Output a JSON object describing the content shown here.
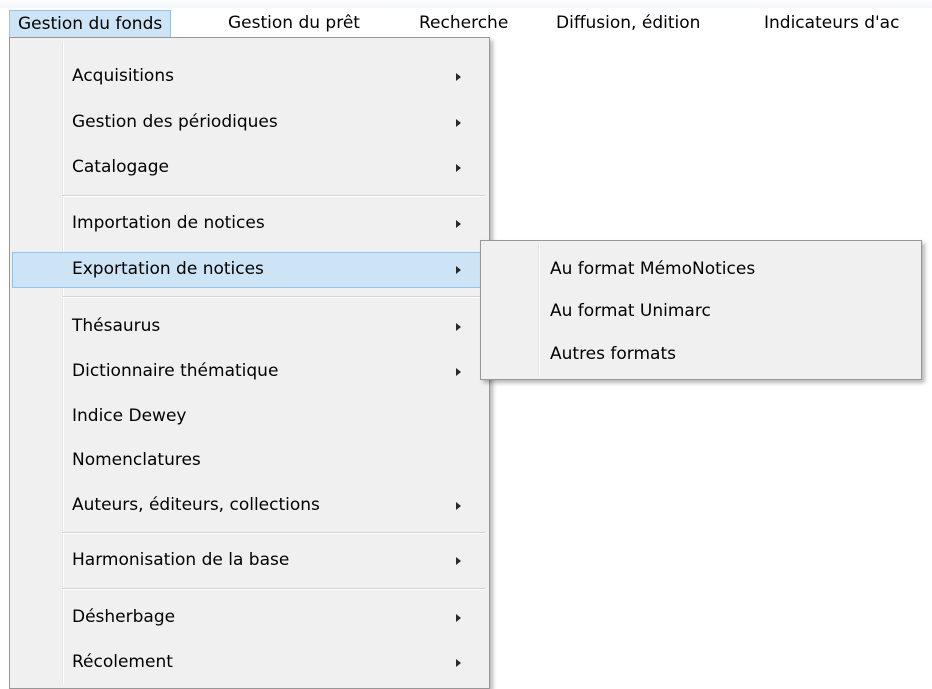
{
  "menubar": {
    "items": [
      {
        "label": "Gestion du fonds"
      },
      {
        "label": "Gestion du prêt"
      },
      {
        "label": "Recherche"
      },
      {
        "label": "Diffusion, édition"
      },
      {
        "label": "Indicateurs d'ac"
      }
    ]
  },
  "main_menu": {
    "items": [
      {
        "label": "Acquisitions",
        "submenu": true
      },
      {
        "label": "Gestion des périodiques",
        "submenu": true
      },
      {
        "label": "Catalogage",
        "submenu": true
      },
      {
        "label": "Importation de notices",
        "submenu": true
      },
      {
        "label": "Exportation de notices",
        "submenu": true,
        "highlighted": true
      },
      {
        "label": "Thésaurus",
        "submenu": true
      },
      {
        "label": "Dictionnaire thématique",
        "submenu": true
      },
      {
        "label": "Indice Dewey",
        "submenu": false
      },
      {
        "label": "Nomenclatures",
        "submenu": false
      },
      {
        "label": "Auteurs, éditeurs, collections",
        "submenu": true
      },
      {
        "label": "Harmonisation de la base",
        "submenu": true
      },
      {
        "label": "Désherbage",
        "submenu": true
      },
      {
        "label": "Récolement",
        "submenu": true
      }
    ]
  },
  "export_submenu": {
    "items": [
      {
        "label": "Au format MémoNotices"
      },
      {
        "label": "Au format Unimarc"
      },
      {
        "label": "Autres formats"
      }
    ]
  },
  "icons": {
    "submenu_arrow": "chevron-right-icon"
  },
  "colors": {
    "highlight_fill": "#cde4f7",
    "highlight_border": "#99c3e6",
    "menu_background": "#f0f0f0"
  }
}
